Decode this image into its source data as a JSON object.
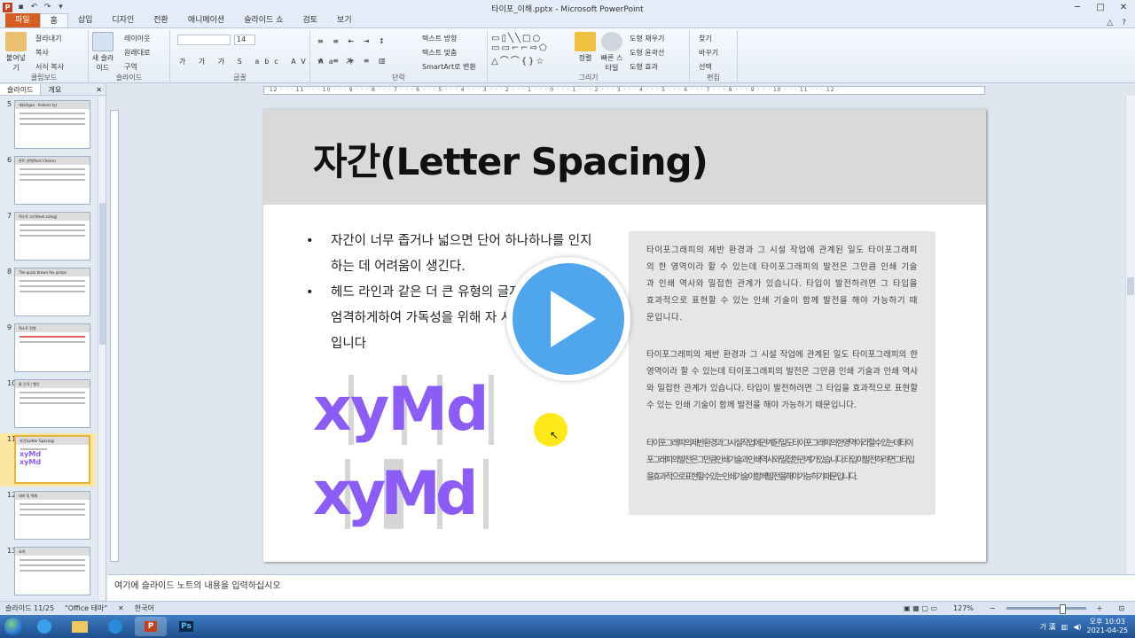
{
  "window": {
    "title": "타이포_이해.pptx - Microsoft PowerPoint",
    "app_icon_label": "P",
    "controls": [
      "─",
      "□",
      "✕"
    ]
  },
  "tabs": [
    "파일",
    "홈",
    "삽입",
    "디자인",
    "전환",
    "애니메이션",
    "슬라이드 쇼",
    "검토",
    "보기"
  ],
  "ribbon": {
    "clipboard": {
      "paste": "붙여넣기",
      "cut": "잘라내기",
      "copy": "복사",
      "format_painter": "서식 복사",
      "label": "클립보드"
    },
    "slides": {
      "new_slide": "새 슬라이드",
      "layout": "레이아웃",
      "reset": "원래대로",
      "section": "구역",
      "label": "슬라이드"
    },
    "font": {
      "size": "14",
      "label": "글꼴",
      "buttons": [
        "가",
        "가",
        "가",
        "S",
        "abc",
        "AV",
        "Aa",
        "가"
      ]
    },
    "paragraph": {
      "text_direction": "텍스트 방향",
      "align_text": "텍스트 맞춤",
      "smartart": "SmartArt로 변환",
      "label": "단락"
    },
    "drawing": {
      "arrange": "정렬",
      "quick_styles": "빠른 스타일",
      "shape_fill": "도형 채우기",
      "shape_outline": "도형 윤곽선",
      "shape_effects": "도형 효과",
      "label": "그리기"
    },
    "editing": {
      "find": "찾기",
      "replace": "바꾸기",
      "select": "선택",
      "label": "편집"
    }
  },
  "left_pane": {
    "tabs": [
      "슬라이드",
      "개요"
    ],
    "close": "✕",
    "thumbnails": [
      {
        "num": "5",
        "title": "개요(typo - historic ty)"
      },
      {
        "num": "6",
        "title": "폰트 선택(font Choice)"
      },
      {
        "num": "7",
        "title": "텍스트 크기(text sizing)"
      },
      {
        "num": "8",
        "title": "The quick brown fox jumps"
      },
      {
        "num": "9",
        "title": "텍스트 정렬"
      },
      {
        "num": "10",
        "title": "줄 간격 / 행간"
      },
      {
        "num": "11",
        "title": "자간(Letter Spacing)",
        "selected": true
      },
      {
        "num": "12",
        "title": "대비 및 색채"
      },
      {
        "num": "13",
        "title": "요약"
      }
    ]
  },
  "ruler_text": "· 12 · · · 11 · · · 10 · · · 9 · · · 8 · · · 7 · · · 6 · · · 5 · · · 4 · · · 3 · · · 2 · · · 1 · · · 0 · · · 1 · · · 2 · · · 3 · · · 4 · · · 5 · · · 6 · · · 7 · · · 8 · · · 9 · · · 10 · · · 11 · · · 12 ·",
  "slide": {
    "title": "자간(Letter Spacing)",
    "bullets": [
      "자간이 너무 좁거나 넓으면 단어 하나하나를 인지하는 데 어려움이 생긴다.",
      "헤드 라인과 같은 더 큰 유형의 글자는 간격을 더 엄격하게하여 가독성을 위해 자 사이의 간격을 줄입니다"
    ],
    "sample_word_1": "xyMd",
    "sample_word_2": "xyMd",
    "paragraphs": [
      "타이포그래피의 제반 환경과 그 시설 작업에 관계된 일도 타이포그래피의 한 영역이라 할 수 있는데 타이포그래피의 발전은 그만큼 인쇄 기술과 인쇄 역사와 밀접한 관계가 있습니다. 타입이 발전하려면 그 타입을 효과적으로 표현할 수 있는 인쇄 기술이 함께 발전을 해야 가능하기 때문입니다.",
      "타이포그래피의 제반 환경과 그 시설 작업에 관계된 일도 타이포그래피의 한 영역이라 할 수 있는데 타이포그래피의 발전은 그만큼 인쇄 기술과 인쇄 역사와 밀접한 관계가 있습니다. 타입이 발전하려면 그 타입을 효과적으로 표현할 수 있는 인쇄 기술이 함께 발전을 해야 가능하기 때문입니다.",
      "타이포그래피의제반환경과그시설작업에관계된일도타이포그래피의한영역이라할수있는데타이포그래피의발전은그만큼인쇄기술과인쇄역사와밀접한관계가있습니다.타입이발전하려면그타입을효과적으로표현할수있는인쇄기술이함께발전을해야가능하기때문입니다."
    ]
  },
  "notes_placeholder": "여기에 슬라이드 노트의 내용을 입력하십시오",
  "status": {
    "slide_counter": "슬라이드 11/25",
    "theme": "\"Office 테마\"",
    "language": "한국어",
    "zoom": "127%"
  },
  "taskbar": {
    "apps": [
      "ie-icon",
      "folder-icon",
      "edge-icon",
      "powerpoint-icon",
      "photoshop-icon"
    ],
    "ppt_label": "P",
    "ps_label": "Ps",
    "ime": "가 漢",
    "time": "오후 10:03",
    "date": "2021-04-25"
  },
  "colors": {
    "accent_purple": "#8b5cf6",
    "play_blue": "#4fa6ec",
    "file_tab": "#d55d1f",
    "cursor_highlight": "#ffe500"
  }
}
